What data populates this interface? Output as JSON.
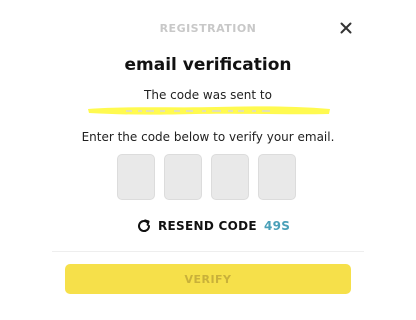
{
  "header": {
    "title": "REGISTRATION",
    "close_icon": "close-icon"
  },
  "main": {
    "title": "email verification",
    "sent_text": "The code was sent to",
    "instruction": "Enter the code below to verify your email.",
    "code_digits": [
      "",
      "",
      "",
      ""
    ]
  },
  "resend": {
    "icon": "refresh-icon",
    "label": "RESEND CODE",
    "timer": "49S"
  },
  "footer": {
    "verify_label": "VERIFY"
  },
  "colors": {
    "accent": "#f6e04a",
    "timer": "#4aa0b8",
    "highlight": "#fffa50"
  }
}
